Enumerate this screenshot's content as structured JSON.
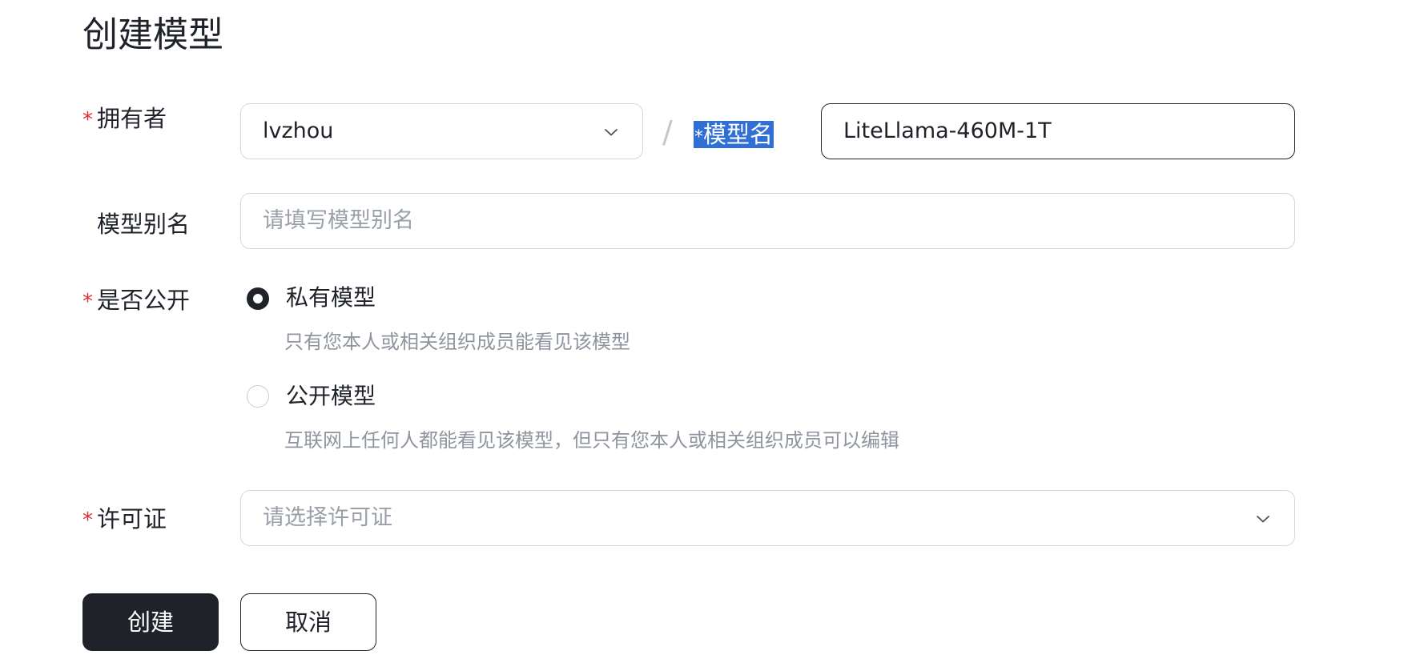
{
  "page": {
    "title": "创建模型"
  },
  "owner": {
    "label": "拥有者",
    "required": "*",
    "value": "lvzhou"
  },
  "separator": "/",
  "model_name": {
    "required": "*",
    "label": "模型名",
    "value": "LiteLlama-460M-1T"
  },
  "alias": {
    "label": "模型别名",
    "placeholder": "请填写模型别名"
  },
  "visibility": {
    "label": "是否公开",
    "required": "*",
    "options": [
      {
        "title": "私有模型",
        "desc": "只有您本人或相关组织成员能看见该模型",
        "checked": true
      },
      {
        "title": "公开模型",
        "desc": "互联网上任何人都能看见该模型，但只有您本人或相关组织成员可以编辑",
        "checked": false
      }
    ]
  },
  "license": {
    "label": "许可证",
    "required": "*",
    "placeholder": "请选择许可证"
  },
  "actions": {
    "create_label": "创建",
    "cancel_label": "取消"
  },
  "icons": {
    "owner_dropdown": "chevron-down-icon",
    "license_dropdown": "chevron-down-icon"
  },
  "colors": {
    "primary": "#1f2329",
    "required": "#e02d2d",
    "selection": "#2f6fd6",
    "placeholder": "#9aa0a8"
  }
}
